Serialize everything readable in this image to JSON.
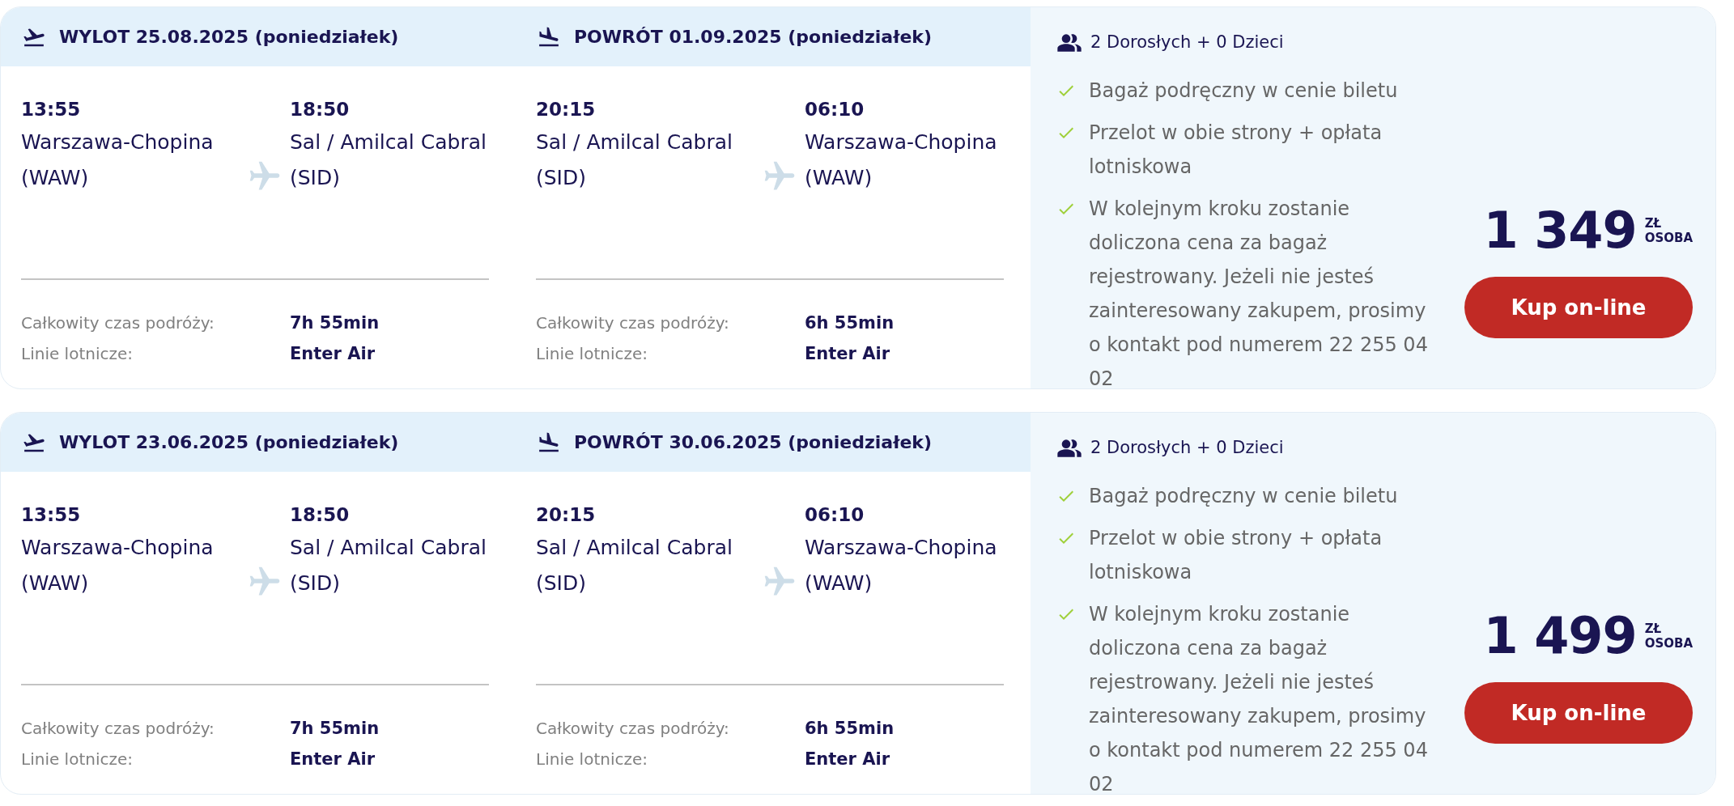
{
  "offers": [
    {
      "legs": [
        {
          "kind": "departure",
          "heading": "WYLOT 25.08.2025 (poniedziałek)",
          "from_time": "13:55",
          "from_city": "Warszawa-Chopina",
          "from_code": "(WAW)",
          "to_time": "18:50",
          "to_city": "Sal / Amilcal Cabral",
          "to_code": "(SID)",
          "duration_label": "Całkowity czas podróży:",
          "duration": "7h 55min",
          "airline_label": "Linie lotnicze:",
          "airline": "Enter Air"
        },
        {
          "kind": "return",
          "heading": "POWRÓT 01.09.2025 (poniedziałek)",
          "from_time": "20:15",
          "from_city": "Sal / Amilcal Cabral",
          "from_code": "(SID)",
          "to_time": "06:10",
          "to_city": "Warszawa-Chopina",
          "to_code": "(WAW)",
          "duration_label": "Całkowity czas podróży:",
          "duration": "6h 55min",
          "airline_label": "Linie lotnicze:",
          "airline": "Enter Air"
        }
      ],
      "passengers": "2 Dorosłych + 0 Dzieci",
      "features": [
        "Bagaż podręczny w cenie biletu",
        "Przelot w obie strony + opłata lotniskowa",
        "W kolejnym kroku zostanie doliczona cena za bagaż rejestrowany. Jeżeli nie jesteś zainteresowany zakupem, prosimy o kontakt pod numerem 22 255 04 02"
      ],
      "price": "1 349",
      "currency": "ZŁ",
      "per": "OSOBA",
      "button": "Kup on-line"
    },
    {
      "legs": [
        {
          "kind": "departure",
          "heading": "WYLOT 23.06.2025 (poniedziałek)",
          "from_time": "13:55",
          "from_city": "Warszawa-Chopina",
          "from_code": "(WAW)",
          "to_time": "18:50",
          "to_city": "Sal / Amilcal Cabral",
          "to_code": "(SID)",
          "duration_label": "Całkowity czas podróży:",
          "duration": "7h 55min",
          "airline_label": "Linie lotnicze:",
          "airline": "Enter Air"
        },
        {
          "kind": "return",
          "heading": "POWRÓT 30.06.2025 (poniedziałek)",
          "from_time": "20:15",
          "from_city": "Sal / Amilcal Cabral",
          "from_code": "(SID)",
          "to_time": "06:10",
          "to_city": "Warszawa-Chopina",
          "to_code": "(WAW)",
          "duration_label": "Całkowity czas podróży:",
          "duration": "6h 55min",
          "airline_label": "Linie lotnicze:",
          "airline": "Enter Air"
        }
      ],
      "passengers": "2 Dorosłych + 0 Dzieci",
      "features": [
        "Bagaż podręczny w cenie biletu",
        "Przelot w obie strony + opłata lotniskowa",
        "W kolejnym kroku zostanie doliczona cena za bagaż rejestrowany. Jeżeli nie jesteś zainteresowany zakupem, prosimy o kontakt pod numerem 22 255 04 02"
      ],
      "price": "1 499",
      "currency": "ZŁ",
      "per": "OSOBA",
      "button": "Kup on-line"
    }
  ]
}
